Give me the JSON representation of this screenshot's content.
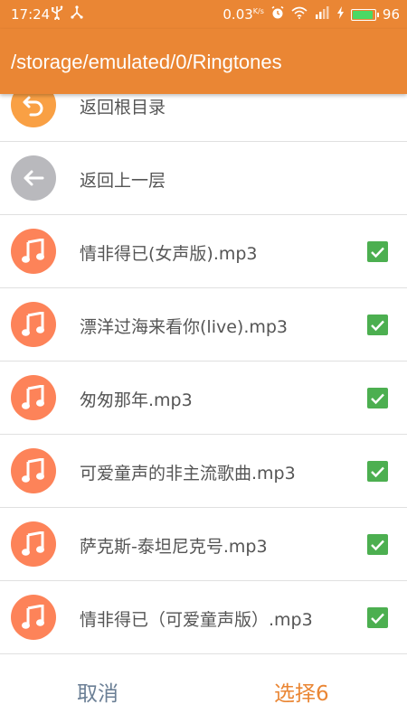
{
  "status_bar": {
    "time": "17:24",
    "left_icons": [
      "usb-icon",
      "share-icon"
    ],
    "speed_value": "0.03",
    "speed_unit": "K/s",
    "battery_level": "96"
  },
  "title_bar": {
    "path": "/storage/emulated/0/Ringtones"
  },
  "list": {
    "items": [
      {
        "label": "返回根目录",
        "type": "nav-root",
        "icon": "undo-icon",
        "checked": false
      },
      {
        "label": "返回上一层",
        "type": "nav-up",
        "icon": "back-arrow-icon",
        "checked": false
      },
      {
        "label": "情非得已(女声版).mp3",
        "type": "file",
        "icon": "music-note-icon",
        "checked": true
      },
      {
        "label": "漂洋过海来看你(live).mp3",
        "type": "file",
        "icon": "music-note-icon",
        "checked": true
      },
      {
        "label": "匆匆那年.mp3",
        "type": "file",
        "icon": "music-note-icon",
        "checked": true
      },
      {
        "label": "可爱童声的非主流歌曲.mp3",
        "type": "file",
        "icon": "music-note-icon",
        "checked": true
      },
      {
        "label": "萨克斯-泰坦尼克号.mp3",
        "type": "file",
        "icon": "music-note-icon",
        "checked": true
      },
      {
        "label": "情非得已（可爱童声版）.mp3",
        "type": "file",
        "icon": "music-note-icon",
        "checked": true
      }
    ]
  },
  "bottom_bar": {
    "cancel_label": "取消",
    "select_label": "选择6"
  },
  "colors": {
    "accent": "#ea8634",
    "file_icon_bg": "#fd8359",
    "root_icon_bg": "#f9a044",
    "up_icon_bg": "#b9b9bd",
    "check_bg": "#4caf50"
  }
}
